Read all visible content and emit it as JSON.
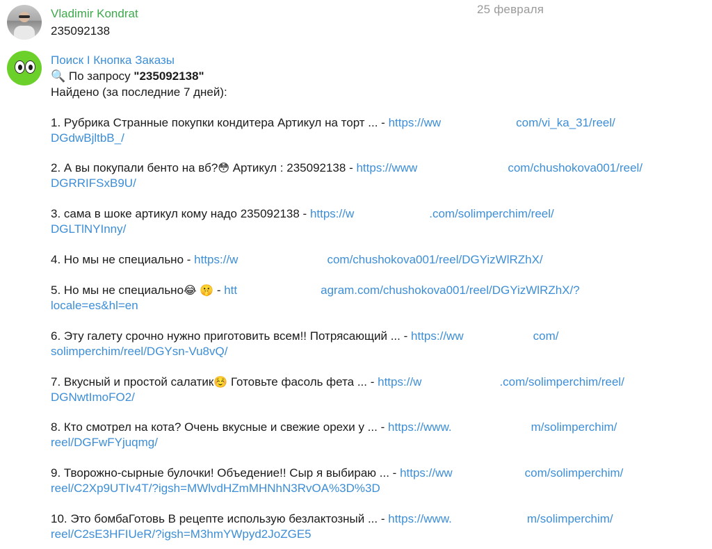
{
  "date_label": "25 февраля",
  "message1": {
    "sender": "Vladimir Kondrat",
    "text": "235092138"
  },
  "message2": {
    "sender": "Поиск I Кнопка Заказы",
    "query_icon": "🔍",
    "query_prefix": "По запросу",
    "query_value": "\"235092138\"",
    "found_label": "Найдено (за последние 7 дней):"
  },
  "results": [
    {
      "num": "1.",
      "text": "Рубрика Странные покупки кондитера Артикул на торт ... -",
      "link_start": "https://ww",
      "link_end": "com/vi_ka_31/reel/",
      "link_line2": "DGdwBjltbB_/"
    },
    {
      "num": "2.",
      "text": "А вы покупали бенто на вб?",
      "emoji": "😳",
      "text_after": "Артикул : 235092138 -",
      "link_start": "https://www",
      "link_end": "com/chushokova001/reel/",
      "link_line2": "DGRRIFSxB9U/"
    },
    {
      "num": "3.",
      "text": "сама в шоке артикул кому надо 235092138 -",
      "link_start": "https://w",
      "link_end": ".com/solimperchim/reel/",
      "link_line2": "DGLTlNYInny/"
    },
    {
      "num": "4.",
      "text": "Но мы не специально -",
      "link_start": "https://w",
      "link_end": "com/chushokova001/reel/DGYizWlRZhX/",
      "link_line2": ""
    },
    {
      "num": "5.",
      "text": "Но мы не специально",
      "emoji": "😂 🤫",
      "text_after": "-",
      "link_start": "htt",
      "link_end": "agram.com/chushokova001/reel/DGYizWlRZhX/?",
      "link_line2": "locale=es&hl=en"
    },
    {
      "num": "6.",
      "text": "Эту галету срочно нужно приготовить всем!! Потрясающий ... -",
      "link_start": "https://ww",
      "link_end": "com/",
      "link_line2": "solimperchim/reel/DGYsn-Vu8vQ/"
    },
    {
      "num": "7.",
      "text": "Вкусный и простой салатик",
      "emoji": "☺️",
      "text_after": "Готовьте фасоль фета ... -",
      "link_start": "https://w",
      "link_end": ".com/solimperchim/reel/",
      "link_line2": "DGNwtImoFO2/"
    },
    {
      "num": "8.",
      "text": "Кто смотрел на кота? Очень вкусные и свежие орехи у ... -",
      "link_start": "https://www.",
      "link_end": "m/solimperchim/",
      "link_line2": "reel/DGFwFYjuqmg/"
    },
    {
      "num": "9.",
      "text": "Творожно-сырные булочки! Объедение!! Сыр я выбираю ... -",
      "link_start": "https://ww",
      "link_end": "com/solimperchim/",
      "link_line2": "reel/C2Xp9UTIv4T/?igsh=MWlvdHZmMHNhN3RvOA%3D%3D"
    },
    {
      "num": "10.",
      "text": "Это бомбаГотовь В рецепте использую безлактозный ... -",
      "link_start": "https://www.",
      "link_end": "m/solimperchim/",
      "link_line2": "reel/C2sE3HFIUeR/?igsh=M3hmYWpyd2JoZGE5"
    }
  ]
}
